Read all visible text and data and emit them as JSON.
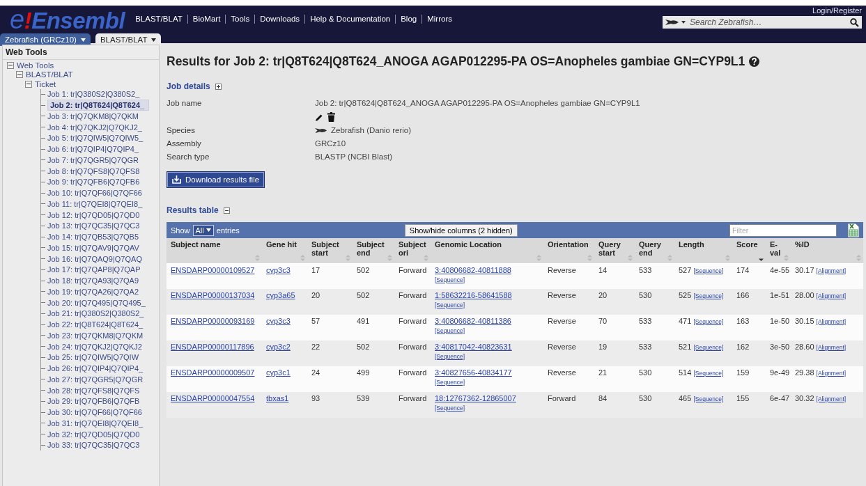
{
  "header": {
    "logo": {
      "letter": "e",
      "accent": "!",
      "word": "Ensembl"
    },
    "nav": [
      "BLAST/BLAT",
      "BioMart",
      "Tools",
      "Downloads",
      "Help & Documentation",
      "Blog",
      "Mirrors"
    ],
    "login": "Login/Register",
    "search": {
      "placeholder": "Search Zebrafish…"
    },
    "tabs": [
      {
        "label": "Zebrafish (GRCz10)",
        "selected": false
      },
      {
        "label": "BLAST/BLAT",
        "selected": true
      }
    ]
  },
  "sidebar": {
    "title": "Web Tools",
    "tree": [
      {
        "label": "Web Tools",
        "expanded": true,
        "children": [
          {
            "label": "BLAST/BLAT",
            "expanded": true,
            "children": [
              {
                "label": "Ticket",
                "expanded": true,
                "children": [
                  {
                    "label": "Job 1: tr|Q380S2|Q380S2_",
                    "selected": false
                  },
                  {
                    "label": "Job 2: tr|Q8T624|Q8T624_",
                    "selected": true
                  },
                  {
                    "label": "Job 3: tr|Q7QKM8|Q7QKM",
                    "selected": false
                  },
                  {
                    "label": "Job 4: tr|Q7QKJ2|Q7QKJ2_",
                    "selected": false
                  },
                  {
                    "label": "Job 5: tr|Q7QIW5|Q7QIW5_",
                    "selected": false
                  },
                  {
                    "label": "Job 6: tr|Q7QIP4|Q7QIP4_",
                    "selected": false
                  },
                  {
                    "label": "Job 7: tr|Q7QGR5|Q7QGR",
                    "selected": false
                  },
                  {
                    "label": "Job 8: tr|Q7QFS8|Q7QFS8",
                    "selected": false
                  },
                  {
                    "label": "Job 9: tr|Q7QFB6|Q7QFB6",
                    "selected": false
                  },
                  {
                    "label": "Job 10: tr|Q7QF66|Q7QF66",
                    "selected": false
                  },
                  {
                    "label": "Job 11: tr|Q7QEI8|Q7QEI8_",
                    "selected": false
                  },
                  {
                    "label": "Job 12: tr|Q7QD05|Q7QD0",
                    "selected": false
                  },
                  {
                    "label": "Job 13: tr|Q7QC35|Q7QC3",
                    "selected": false
                  },
                  {
                    "label": "Job 14: tr|Q7QB53|Q7QB5",
                    "selected": false
                  },
                  {
                    "label": "Job 15: tr|Q7QAV9|Q7QAV",
                    "selected": false
                  },
                  {
                    "label": "Job 16: tr|Q7QAQ9|Q7QAQ",
                    "selected": false
                  },
                  {
                    "label": "Job 17: tr|Q7QAP8|Q7QAP",
                    "selected": false
                  },
                  {
                    "label": "Job 18: tr|Q7QA93|Q7QA9",
                    "selected": false
                  },
                  {
                    "label": "Job 19: tr|Q7QA26|Q7QA2",
                    "selected": false
                  },
                  {
                    "label": "Job 20: tr|Q7Q495|Q7Q495_",
                    "selected": false
                  },
                  {
                    "label": "Job 21: tr|Q380S2|Q380S2_",
                    "selected": false
                  },
                  {
                    "label": "Job 22: tr|Q8T624|Q8T624_",
                    "selected": false
                  },
                  {
                    "label": "Job 23: tr|Q7QKM8|Q7QKM",
                    "selected": false
                  },
                  {
                    "label": "Job 24: tr|Q7QKJ2|Q7QKJ2",
                    "selected": false
                  },
                  {
                    "label": "Job 25: tr|Q7QIW5|Q7QIW",
                    "selected": false
                  },
                  {
                    "label": "Job 26: tr|Q7QIP4|Q7QIP4_",
                    "selected": false
                  },
                  {
                    "label": "Job 27: tr|Q7QGR5|Q7QGR",
                    "selected": false
                  },
                  {
                    "label": "Job 28: tr|Q7QFS8|Q7QFS",
                    "selected": false
                  },
                  {
                    "label": "Job 29: tr|Q7QFB6|Q7QFB",
                    "selected": false
                  },
                  {
                    "label": "Job 30: tr|Q7QF66|Q7QF66",
                    "selected": false
                  },
                  {
                    "label": "Job 31: tr|Q7QEI8|Q7QEI8_",
                    "selected": false
                  },
                  {
                    "label": "Job 32: tr|Q7QD05|Q7QD0",
                    "selected": false
                  },
                  {
                    "label": "Job 33: tr|Q7QC35|Q7QC3",
                    "selected": false
                  }
                ]
              }
            ]
          }
        ]
      }
    ]
  },
  "main": {
    "title": "Results for Job 2: tr|Q8T624|Q8T624_ANOGA AGAP012295-PA OS=Anopheles gambiae GN=CYP9L1",
    "job_details": {
      "heading": "Job details",
      "expanded": false,
      "fields": [
        {
          "label": "Job name",
          "value": "Job 2: tr|Q8T624|Q8T624_ANOGA AGAP012295-PA OS=Anopheles gambiae GN=CYP9L1",
          "kind": "name"
        },
        {
          "label": "Species",
          "value": "Zebrafish (Danio rerio)",
          "kind": "species"
        },
        {
          "label": "Assembly",
          "value": "GRCz10",
          "kind": "plain"
        },
        {
          "label": "Search type",
          "value": "BLASTP (NCBI Blast)",
          "kind": "plain"
        }
      ]
    },
    "download_button": "Download results file",
    "results": {
      "heading": "Results table",
      "expanded": true,
      "toolbar": {
        "show": "Show",
        "entries_select": "All",
        "entries": "entries",
        "columns_button": "Show/hide columns (2 hidden)",
        "filter": {
          "placeholder": "Filter"
        }
      },
      "columns": [
        {
          "label": "Subject name",
          "sorted": false
        },
        {
          "label": "Gene hit",
          "sorted": false
        },
        {
          "label": "Subject start",
          "sorted": false
        },
        {
          "label": "Subject end",
          "sorted": false
        },
        {
          "label": "Subject ori",
          "sorted": false
        },
        {
          "label": "Genomic Location",
          "sorted": false
        },
        {
          "label": "Orientation",
          "sorted": false
        },
        {
          "label": "Query start",
          "sorted": false
        },
        {
          "label": "Query end",
          "sorted": false
        },
        {
          "label": "Length",
          "sorted": false
        },
        {
          "label": "Score",
          "sorted": true
        },
        {
          "label": "E-val",
          "sorted": false
        },
        {
          "label": "%ID",
          "sorted": false
        }
      ],
      "rows": [
        {
          "subject": "ENSDARP00000109527",
          "gene": "cyp3c3",
          "s_start": "17",
          "s_end": "502",
          "ori": "Forward",
          "location": "3:40806682-40811888",
          "location_link": "[Sequence]",
          "orientation": "Reverse",
          "q_start": "14",
          "q_end": "533",
          "length": "527",
          "length_link": "[Sequence]",
          "score": "174",
          "evalue": "4e-55",
          "pid": "30.17",
          "pid_link": "[Alignment]"
        },
        {
          "subject": "ENSDARP00000137034",
          "gene": "cyp3a65",
          "s_start": "20",
          "s_end": "502",
          "ori": "Forward",
          "location": "1:58632216-58641588",
          "location_link": "[Sequence]",
          "orientation": "Reverse",
          "q_start": "20",
          "q_end": "530",
          "length": "525",
          "length_link": "[Sequence]",
          "score": "166",
          "evalue": "1e-51",
          "pid": "28.00",
          "pid_link": "[Alignment]"
        },
        {
          "subject": "ENSDARP00000093169",
          "gene": "cyp3c3",
          "s_start": "57",
          "s_end": "491",
          "ori": "Forward",
          "location": "3:40806682-40811386",
          "location_link": "[Sequence]",
          "orientation": "Reverse",
          "q_start": "70",
          "q_end": "533",
          "length": "471",
          "length_link": "[Sequence]",
          "score": "163",
          "evalue": "1e-50",
          "pid": "30.15",
          "pid_link": "[Alignment]"
        },
        {
          "subject": "ENSDARP00000117896",
          "gene": "cyp3c2",
          "s_start": "22",
          "s_end": "502",
          "ori": "Forward",
          "location": "3:40817042-40823631",
          "location_link": "[Sequence]",
          "orientation": "Reverse",
          "q_start": "19",
          "q_end": "533",
          "length": "521",
          "length_link": "[Sequence]",
          "score": "162",
          "evalue": "3e-50",
          "pid": "28.60",
          "pid_link": "[Alignment]"
        },
        {
          "subject": "ENSDARP00000009507",
          "gene": "cyp3c1",
          "s_start": "24",
          "s_end": "499",
          "ori": "Forward",
          "location": "3:40827656-40834177",
          "location_link": "[Sequence]",
          "orientation": "Reverse",
          "q_start": "21",
          "q_end": "530",
          "length": "514",
          "length_link": "[Sequence]",
          "score": "159",
          "evalue": "9e-49",
          "pid": "29.38",
          "pid_link": "[Alignment]"
        },
        {
          "subject": "ENSDARP00000047554",
          "gene": "tbxas1",
          "s_start": "93",
          "s_end": "539",
          "ori": "Forward",
          "location": "18:12767362-12865007",
          "location_link": "[Sequence]",
          "orientation": "Forward",
          "q_start": "84",
          "q_end": "530",
          "length": "465",
          "length_link": "[Sequence]",
          "score": "155",
          "evalue": "6e-47",
          "pid": "30.32",
          "pid_link": "[Alignment]"
        }
      ]
    }
  }
}
